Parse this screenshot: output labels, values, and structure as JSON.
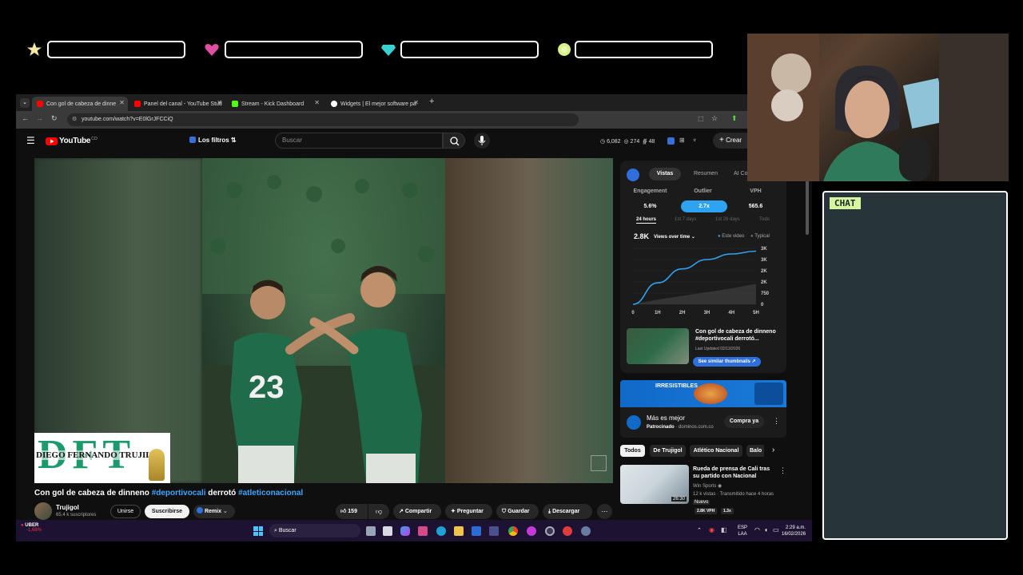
{
  "browser": {
    "tabs": [
      {
        "title": "Con gol de cabeza de dinne",
        "color": "#ff0000"
      },
      {
        "title": "Panel del canal - YouTube Stud",
        "color": "#ff0000"
      },
      {
        "title": "Stream - Kick Dashboard",
        "color": "#53fc18"
      },
      {
        "title": "Widgets | El mejor software pa",
        "color": "#ffffff"
      }
    ],
    "url": "youtube.com/watch?v=E0lGrJFCCiQ"
  },
  "youtube": {
    "logo": "YouTube",
    "logo_sup": "CO",
    "filters": "Los filtros",
    "search_placeholder": "Buscar",
    "stats": {
      "views": "6,082",
      "v2": "274",
      "v3": "48"
    },
    "create": "Crear"
  },
  "panel": {
    "tabs": [
      "Vistas",
      "Resumen",
      "AI Co"
    ],
    "metrics": [
      {
        "label": "Engagement",
        "value": "5.6%"
      },
      {
        "label": "Outlier",
        "value": "2.7x"
      },
      {
        "label": "VPH",
        "value": "565.6"
      }
    ],
    "ranges": [
      "24 hours",
      "1st 7 days",
      "1st 28 days",
      "Todo"
    ],
    "total": "2.8K",
    "views_label": "Views over time",
    "legend": [
      "Este video",
      "Typical"
    ],
    "thumb_title": "Con gol de cabeza de dinneno #deportivocali derrotó...",
    "updated": "Last Updated 02/13/2026",
    "similar": "See similar thumbnails"
  },
  "chart_data": {
    "type": "area",
    "x": [
      "0",
      "1H",
      "2H",
      "3H",
      "4H",
      "5H"
    ],
    "series": [
      {
        "name": "Este video",
        "values": [
          0,
          1150,
          1900,
          2400,
          2700,
          2850
        ]
      },
      {
        "name": "Typical",
        "values": [
          0,
          250,
          450,
          650,
          850,
          1100
        ]
      }
    ],
    "y_ticks": [
      "0",
      "750",
      "2K",
      "2K",
      "3K",
      "3K"
    ],
    "ylim": [
      0,
      3000
    ]
  },
  "ad": {
    "banner": "IRRESISTIBLES",
    "title": "Más es mejor",
    "sponsor": "Patrocinado",
    "domain": "dominos.com.co",
    "cta": "Compra ya"
  },
  "chips": [
    "Todos",
    "De Trujigol",
    "Atlético Nacional",
    "Balo"
  ],
  "rec": {
    "title": "Rueda de prensa de Cali tras su partido con Nacional",
    "channel": "Win Sports",
    "meta": "12 k vistas · Transmitido hace 4 horas",
    "badge": "Nuevo",
    "vph": "2.8K VPH",
    "ratio": "1.3x",
    "duration": "26:30"
  },
  "video": {
    "title_plain_1": "Con gol de cabeza de dinneno ",
    "tag1": "#deportivocali",
    "title_plain_2": " derrotó ",
    "tag2": "#atleticonacional",
    "channel": "Trujigol",
    "subs": "65.4 k suscriptores",
    "join": "Unirse",
    "subscribe": "Suscribirse",
    "remix": "Remix",
    "likes": "159",
    "share": "Compartir",
    "ask": "Preguntar",
    "save": "Guardar",
    "download": "Descargar",
    "logo_text": "DFT",
    "logo_name": "DIEGO FERNANDO TRUJILL",
    "jersey": "23"
  },
  "chat": {
    "title": "CHAT"
  },
  "taskbar": {
    "ticker": "UBER",
    "ticker_change": "-1,68%",
    "search": "Buscar",
    "lang1": "ESP",
    "lang2": "LAA",
    "time": "2:29 a.m.",
    "date": "16/02/2026"
  }
}
